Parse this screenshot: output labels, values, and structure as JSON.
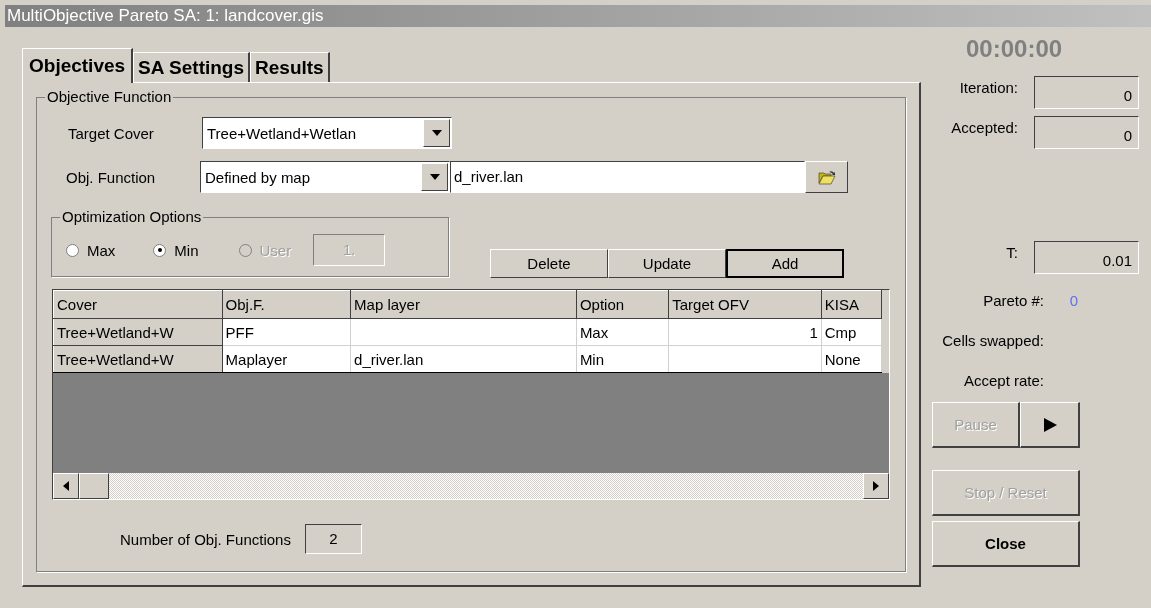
{
  "window": {
    "title": "MultiObjective Pareto SA: 1: landcover.gis"
  },
  "tabs": [
    {
      "label": "Objectives",
      "selected": true
    },
    {
      "label": "SA Settings",
      "selected": false
    },
    {
      "label": "Results",
      "selected": false
    }
  ],
  "objective_function": {
    "title": "Objective Function",
    "target_cover": {
      "label": "Target Cover",
      "value": "Tree+Wetland+Wetlan"
    },
    "obj_function": {
      "label": "Obj. Function",
      "value": "Defined by map",
      "file": "d_river.lan"
    },
    "optimization_options": {
      "title": "Optimization Options",
      "user_value": "1.",
      "options": [
        {
          "label": "Max",
          "selected": false,
          "disabled": false
        },
        {
          "label": "Min",
          "selected": true,
          "disabled": false
        },
        {
          "label": "User",
          "selected": false,
          "disabled": true
        }
      ]
    },
    "buttons": [
      {
        "label": "Delete",
        "default": false
      },
      {
        "label": "Update",
        "default": false
      },
      {
        "label": "Add",
        "default": true
      }
    ],
    "table": {
      "columns": [
        "Cover",
        "Obj.F.",
        "Map layer",
        "Option",
        "Target OFV",
        "KISA"
      ],
      "rows": [
        {
          "cells": [
            "Tree+Wetland+W",
            "PFF",
            "",
            "Max",
            "1",
            "Cmp"
          ]
        },
        {
          "cells": [
            "Tree+Wetland+W",
            "Maplayer",
            "d_river.lan",
            "Min",
            "",
            "None"
          ]
        }
      ]
    },
    "count": {
      "label": "Number of Obj. Functions",
      "value": "2"
    }
  },
  "status": {
    "timer": "00:00:00",
    "counters": [
      {
        "label": "Iteration:",
        "value": "0"
      },
      {
        "label": "Accepted:",
        "value": "0"
      }
    ],
    "temperature": {
      "label": "T:",
      "value": "0.01"
    },
    "readouts": [
      {
        "label": "Pareto #:",
        "value": "0"
      },
      {
        "label": "Cells swapped:"
      },
      {
        "label": "Accept rate:"
      }
    ],
    "pause": {
      "label": "Pause",
      "disabled": true
    },
    "play": {
      "disabled": false
    },
    "stop": {
      "label": "Stop / Reset",
      "disabled": true
    },
    "close": {
      "label": "Close",
      "disabled": false
    }
  }
}
